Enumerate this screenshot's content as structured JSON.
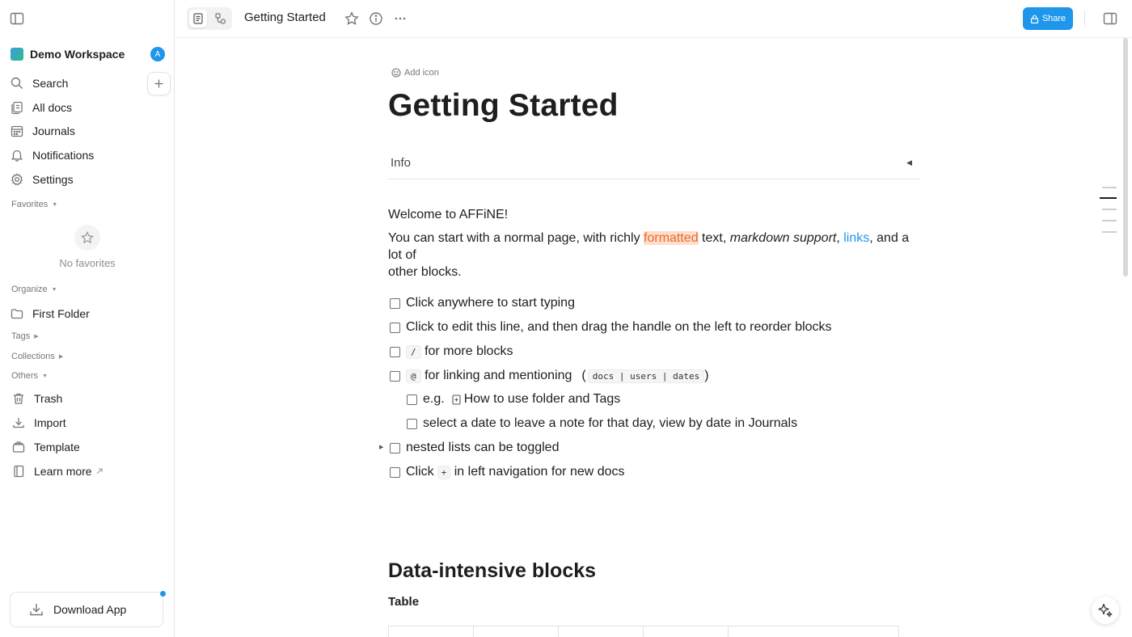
{
  "sidebar": {
    "workspace_name": "Demo Workspace",
    "workspace_avatar": "A",
    "nav": {
      "search": "Search",
      "all_docs": "All docs",
      "journals": "Journals",
      "notifications": "Notifications",
      "settings": "Settings"
    },
    "sections": {
      "favorites": "Favorites",
      "organize": "Organize",
      "tags": "Tags",
      "collections": "Collections",
      "others": "Others"
    },
    "no_favorites": "No favorites",
    "folder": "First Folder",
    "others": {
      "trash": "Trash",
      "import": "Import",
      "template": "Template",
      "learn_more": "Learn more"
    },
    "download_app": "Download App"
  },
  "header": {
    "doc_title": "Getting Started",
    "share_label": "Share"
  },
  "doc": {
    "add_icon": "Add icon",
    "title": "Getting Started",
    "info_label": "Info",
    "welcome": "Welcome to AFFiNE!",
    "intro": {
      "p1": "You can start with a normal page, with richly ",
      "highlight": "formatted",
      "p2": " text, ",
      "italic": "markdown support",
      "p3": ", ",
      "link": "links",
      "p4": ", and a lot of",
      "line2": "other blocks."
    },
    "todos": {
      "t1": "Click anywhere to start typing",
      "t2": "Click to edit this line, and then drag the handle on the left to reorder blocks",
      "t3_code": "/",
      "t3": " for more blocks",
      "t4_code": "@",
      "t4": " for linking and mentioning",
      "t4_paren_open": "(",
      "t4_code2": "docs | users | dates",
      "t4_paren_close": ")",
      "t5_prefix": "e.g.",
      "t5_link": "How to use folder and Tags",
      "t6": "select a date to leave a note for that day, view by date in Journals",
      "t7": "nested lists can be toggled",
      "t8_prefix": "Click",
      "t8_code": "+",
      "t8": " in left navigation for new docs"
    },
    "heading2": "Data-intensive blocks",
    "heading4": "Table"
  },
  "colors": {
    "accent": "#1e96eb",
    "highlight_bg": "#ffdecb",
    "highlight_text": "#e56a2d"
  }
}
